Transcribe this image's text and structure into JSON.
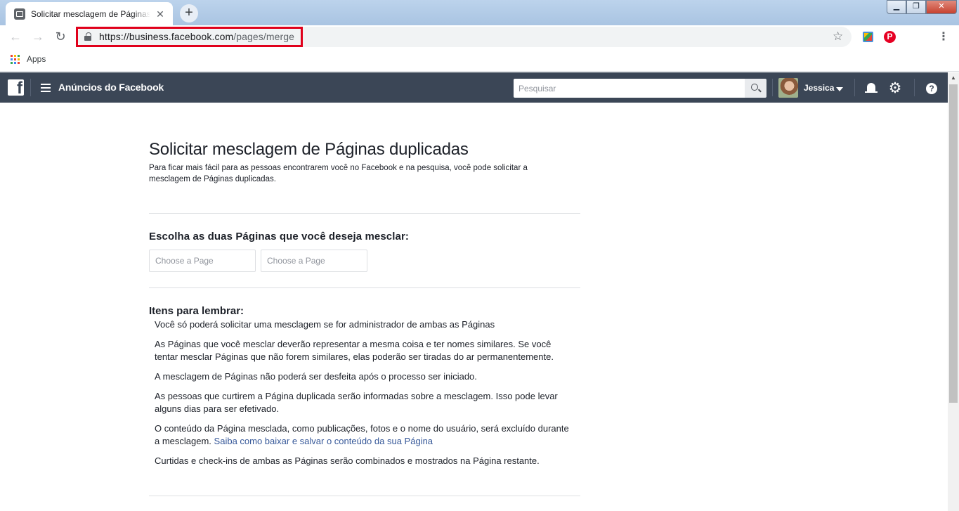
{
  "browser": {
    "tab_title": "Solicitar mesclagem de Páginas d",
    "url_host": "https://business.facebook.com",
    "url_path": "/pages/merge",
    "bookmarks_apps_label": "Apps"
  },
  "fb_header": {
    "title": "Anúncios do Facebook",
    "search_placeholder": "Pesquisar",
    "user_name": "Jessica"
  },
  "page": {
    "title": "Solicitar mesclagem de Páginas duplicadas",
    "description": "Para ficar mais fácil para as pessoas encontrarem você no Facebook e na pesquisa, você pode solicitar a mesclagem de Páginas duplicadas.",
    "choose_heading": "Escolha as duas Páginas que você deseja mesclar:",
    "page_input_1_placeholder": "Choose a Page",
    "page_input_2_placeholder": "Choose a Page",
    "remember_heading": "Itens para lembrar:",
    "items": [
      "Você só poderá solicitar uma mesclagem se for administrador de ambas as Páginas",
      "As Páginas que você mesclar deverão representar a mesma coisa e ter nomes similares. Se você tentar mesclar Páginas que não forem similares, elas poderão ser tiradas do ar permanentemente.",
      "A mesclagem de Páginas não poderá ser desfeita após o processo ser iniciado.",
      "As pessoas que curtirem a Página duplicada serão informadas sobre a mesclagem. Isso pode levar alguns dias para ser efetivado.",
      "O conteúdo da Página mesclada, como publicações, fotos e o nome do usuário, será excluído durante a mesclagem.",
      "Curtidas e check-ins de ambas as Páginas serão combinados e mostrados na Página restante."
    ],
    "help_link": "Saiba como baixar e salvar o conteúdo da sua Página"
  },
  "colors": {
    "fb_header_bg": "#3b4656",
    "link": "#365899",
    "url_highlight": "#e0001b"
  }
}
